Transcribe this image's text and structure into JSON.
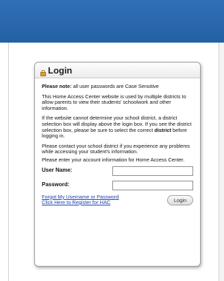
{
  "login": {
    "title": "Login",
    "note_label": "Please note:",
    "note_text": " all user passwords are Case Sensitive",
    "para_intro": "This Home Access Center website is used by multiple districts to allow parents to view their students' schoolwork and other information.",
    "para_district_a": "If the website cannot determine your school district, a district selection box will display above the login box. If you see the district selection box, please be sure to select the correct ",
    "para_district_b": "district",
    "para_district_c": " before logging in.",
    "para_contact": "Please contact your school district if you experience any problems while accessing your student's information.",
    "para_enter": "Please enter your account information for Home Access Center.",
    "username_label": "User Name:",
    "username_value": "",
    "password_label": "Password:",
    "password_value": "",
    "forgot_link": "Forgot My Username or Password",
    "register_link": "Click Here to Register for HAC",
    "login_button": "Login"
  },
  "colors": {
    "header_blue": "#2a67ad",
    "link_blue": "#1a3fb0"
  },
  "icons": {
    "title_icon": "lock-icon"
  }
}
